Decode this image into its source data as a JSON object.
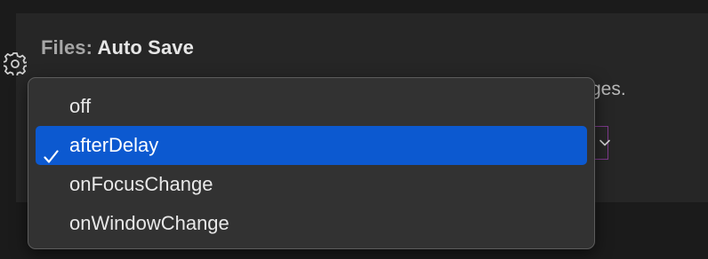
{
  "setting": {
    "category": "Files:",
    "name": "Auto Save",
    "description_visible_tail": "ges."
  },
  "dropdown": {
    "selected_index": 1,
    "selected_value": "afterDelay",
    "options": [
      {
        "label": "off"
      },
      {
        "label": "afterDelay"
      },
      {
        "label": "onFocusChange"
      },
      {
        "label": "onWindowChange"
      }
    ]
  },
  "colors": {
    "panel_background": "#262626",
    "dropdown_background": "#323232",
    "selection_highlight": "#0c59d0",
    "select_focus_border": "#7d3a8c"
  },
  "icons": {
    "setting_gear": "gear-icon",
    "selected_marker": "check-icon",
    "select_arrow": "chevron-down-icon"
  }
}
